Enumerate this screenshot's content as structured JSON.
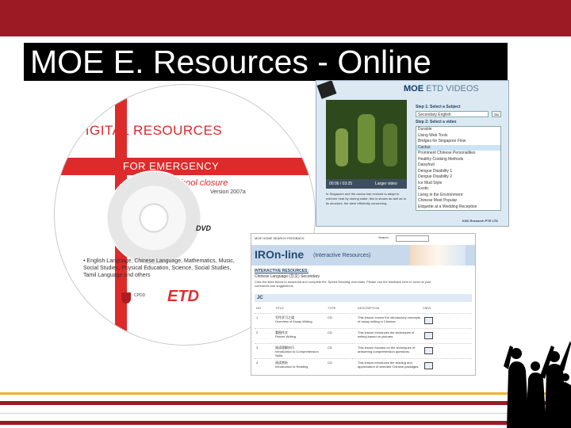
{
  "slide": {
    "title": "MOE E. Resources - Online",
    "colors": {
      "header": "#9b1a24",
      "accent_yellow": "#f0b22a",
      "title_bg": "#000000",
      "title_text": "#ffffff"
    }
  },
  "disc": {
    "line1": "DIGITAL RESOURCES",
    "line2": "FOR EMERGENCY",
    "line3": "school closure",
    "version": "Version 2007a",
    "format": "DVD",
    "subjects": "• English Language, Chinese Language, Mathematics, Music, Social Studies, Physical Education, Science, Social Studies, Tamil Language and others",
    "org_text": "CPDD",
    "logo_text": "ETD"
  },
  "etd_videos": {
    "brand": "MOE",
    "brand_suffix": "ETD VIDEOS",
    "step1": "Step 1: Select a Subject",
    "subject_value": "Secondary English",
    "go": "Go",
    "step2": "Step 2: Select a video",
    "videos": [
      "Durable",
      "Using Web Tools",
      "Bridges for Singapore Flow",
      "Cactus",
      "Prominent Chinese Personalities",
      "Healthy Cooking Methods",
      "Daisyfruit",
      "Dengue Disability 1",
      "Dengue Disability 2",
      "Ice Mud Style",
      "Exotic",
      "Living in the Environment",
      "Chinese Most Popular",
      "Etiquette at a Wedding Reception"
    ],
    "selected_video": "Cactus",
    "time": "00:06 / 03:25",
    "larger_video": "Larger video",
    "description": "In Singapore and the cactus has evolved to adapt to extreme heat by storing water; this is shown as well as to its structure, the stem efficiently conserving.",
    "footer": "KSK Research PTE LTD"
  },
  "ironline": {
    "topnav": "MOE  HOME  SEARCH  FEEDBACK",
    "search_label": "Search",
    "logo": "IROn-line",
    "logo_sub": "(Interactive Resources)",
    "heading": "INTERACTIVE RESOURCES:",
    "language": "Chinese Language (华文)  Secondary",
    "note": "Click the titles below to download and complete the 'Speed Reading' exercises. Please use the feedback form to send us your comments and suggestions.",
    "section": "JC",
    "columns": [
      "NO",
      "TITLE",
      "TYPE",
      "DESCRIPTION",
      "VIEW"
    ],
    "rows": [
      {
        "no": "1",
        "title": "写作学习之道\nOverview of Essay Writing",
        "type": "CD",
        "desc": "This lesson covers the introductory concepts of essay writing in Chinese."
      },
      {
        "no": "2",
        "title": "看图作文\nPicture Writing",
        "type": "CD",
        "desc": "This lesson introduces the techniques of writing based on pictures."
      },
      {
        "no": "3",
        "title": "阅读理解技巧\nIntroduction to Comprehension Skills",
        "type": "CD",
        "desc": "This lesson focuses on the techniques of answering comprehension questions."
      },
      {
        "no": "4",
        "title": "阅读赏析\nIntroduction to Reading",
        "type": "CD",
        "desc": "This lesson introduces the reading and appreciation of selected Chinese passages."
      }
    ]
  }
}
